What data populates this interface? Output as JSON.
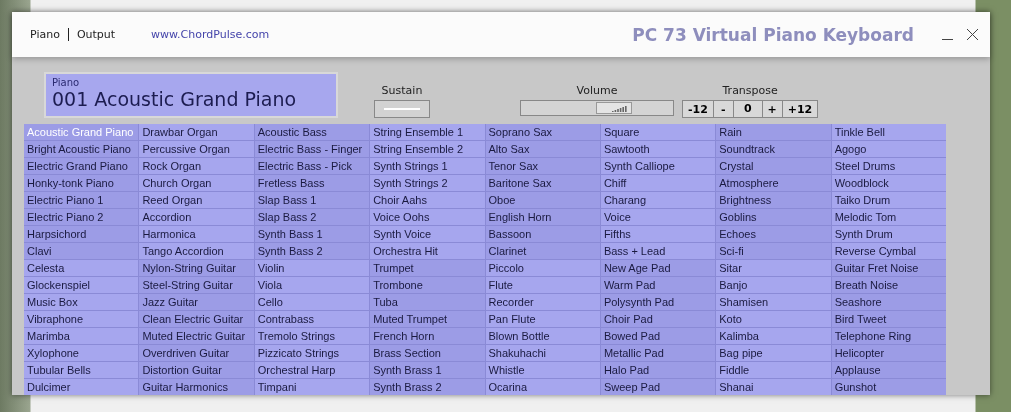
{
  "menu": [
    {
      "label": "Piano"
    },
    {
      "label": "Output"
    }
  ],
  "link": "www.ChordPulse.com",
  "window": {
    "title": "PC 73 Virtual Piano Keyboard"
  },
  "display": {
    "label": "Piano",
    "value": "001 Acoustic Grand Piano"
  },
  "sustain": {
    "label": "Sustain"
  },
  "volume": {
    "label": "Volume",
    "level": 0.66
  },
  "transpose": {
    "label": "Transpose",
    "buttons": [
      {
        "label": "-12",
        "kind": "button"
      },
      {
        "label": "-",
        "kind": "button"
      },
      {
        "label": "0",
        "kind": "value"
      },
      {
        "label": "+",
        "kind": "button"
      },
      {
        "label": "+12",
        "kind": "button"
      }
    ]
  },
  "instruments": [
    [
      {
        "name": "Acoustic Grand Piano",
        "selected": true
      },
      {
        "name": "Bright Acoustic Piano",
        "selected": false
      },
      {
        "name": "Electric Grand Piano",
        "selected": false
      },
      {
        "name": "Honky-tonk Piano",
        "selected": false
      },
      {
        "name": "Electric Piano 1",
        "selected": false
      },
      {
        "name": "Electric Piano 2",
        "selected": false
      },
      {
        "name": "Harpsichord",
        "selected": false
      },
      {
        "name": "Clavi",
        "selected": false
      },
      {
        "name": "Celesta",
        "selected": false
      },
      {
        "name": "Glockenspiel",
        "selected": false
      },
      {
        "name": "Music Box",
        "selected": false
      },
      {
        "name": "Vibraphone",
        "selected": false
      },
      {
        "name": "Marimba",
        "selected": false
      },
      {
        "name": "Xylophone",
        "selected": false
      },
      {
        "name": "Tubular Bells",
        "selected": false
      },
      {
        "name": "Dulcimer",
        "selected": false
      }
    ],
    [
      {
        "name": "Drawbar Organ",
        "selected": false
      },
      {
        "name": "Percussive Organ",
        "selected": false
      },
      {
        "name": "Rock Organ",
        "selected": false
      },
      {
        "name": "Church Organ",
        "selected": false
      },
      {
        "name": "Reed Organ",
        "selected": false
      },
      {
        "name": "Accordion",
        "selected": false
      },
      {
        "name": "Harmonica",
        "selected": false
      },
      {
        "name": "Tango Accordion",
        "selected": false
      },
      {
        "name": "Nylon-String Guitar",
        "selected": false
      },
      {
        "name": "Steel-String Guitar",
        "selected": false
      },
      {
        "name": "Jazz Guitar",
        "selected": false
      },
      {
        "name": "Clean Electric Guitar",
        "selected": false
      },
      {
        "name": "Muted Electric Guitar",
        "selected": false
      },
      {
        "name": "Overdriven Guitar",
        "selected": false
      },
      {
        "name": "Distortion Guitar",
        "selected": false
      },
      {
        "name": "Guitar Harmonics",
        "selected": false
      }
    ],
    [
      {
        "name": "Acoustic Bass",
        "selected": false
      },
      {
        "name": "Electric Bass - Finger",
        "selected": false
      },
      {
        "name": "Electric Bass - Pick",
        "selected": false
      },
      {
        "name": "Fretless Bass",
        "selected": false
      },
      {
        "name": "Slap Bass 1",
        "selected": false
      },
      {
        "name": "Slap Bass 2",
        "selected": false
      },
      {
        "name": "Synth Bass 1",
        "selected": false
      },
      {
        "name": "Synth Bass 2",
        "selected": false
      },
      {
        "name": "Violin",
        "selected": false
      },
      {
        "name": "Viola",
        "selected": false
      },
      {
        "name": "Cello",
        "selected": false
      },
      {
        "name": "Contrabass",
        "selected": false
      },
      {
        "name": "Tremolo Strings",
        "selected": false
      },
      {
        "name": "Pizzicato Strings",
        "selected": false
      },
      {
        "name": "Orchestral Harp",
        "selected": false
      },
      {
        "name": "Timpani",
        "selected": false
      }
    ],
    [
      {
        "name": "String Ensemble 1",
        "selected": false
      },
      {
        "name": "String Ensemble 2",
        "selected": false
      },
      {
        "name": "Synth Strings 1",
        "selected": false
      },
      {
        "name": "Synth Strings 2",
        "selected": false
      },
      {
        "name": "Choir Aahs",
        "selected": false
      },
      {
        "name": "Voice Oohs",
        "selected": false
      },
      {
        "name": "Synth Voice",
        "selected": false
      },
      {
        "name": "Orchestra Hit",
        "selected": false
      },
      {
        "name": "Trumpet",
        "selected": false
      },
      {
        "name": "Trombone",
        "selected": false
      },
      {
        "name": "Tuba",
        "selected": false
      },
      {
        "name": "Muted Trumpet",
        "selected": false
      },
      {
        "name": "French Horn",
        "selected": false
      },
      {
        "name": "Brass Section",
        "selected": false
      },
      {
        "name": "Synth Brass 1",
        "selected": false
      },
      {
        "name": "Synth Brass 2",
        "selected": false
      }
    ],
    [
      {
        "name": "Soprano Sax",
        "selected": false
      },
      {
        "name": "Alto Sax",
        "selected": false
      },
      {
        "name": "Tenor Sax",
        "selected": false
      },
      {
        "name": "Baritone Sax",
        "selected": false
      },
      {
        "name": "Oboe",
        "selected": false
      },
      {
        "name": "English Horn",
        "selected": false
      },
      {
        "name": "Bassoon",
        "selected": false
      },
      {
        "name": "Clarinet",
        "selected": false
      },
      {
        "name": "Piccolo",
        "selected": false
      },
      {
        "name": "Flute",
        "selected": false
      },
      {
        "name": "Recorder",
        "selected": false
      },
      {
        "name": "Pan Flute",
        "selected": false
      },
      {
        "name": "Blown Bottle",
        "selected": false
      },
      {
        "name": "Shakuhachi",
        "selected": false
      },
      {
        "name": "Whistle",
        "selected": false
      },
      {
        "name": "Ocarina",
        "selected": false
      }
    ],
    [
      {
        "name": "Square",
        "selected": false
      },
      {
        "name": "Sawtooth",
        "selected": false
      },
      {
        "name": "Synth Calliope",
        "selected": false
      },
      {
        "name": "Chiff",
        "selected": false
      },
      {
        "name": "Charang",
        "selected": false
      },
      {
        "name": "Voice",
        "selected": false
      },
      {
        "name": "Fifths",
        "selected": false
      },
      {
        "name": "Bass + Lead",
        "selected": false
      },
      {
        "name": "New Age Pad",
        "selected": false
      },
      {
        "name": "Warm Pad",
        "selected": false
      },
      {
        "name": "Polysynth Pad",
        "selected": false
      },
      {
        "name": "Choir Pad",
        "selected": false
      },
      {
        "name": "Bowed Pad",
        "selected": false
      },
      {
        "name": "Metallic Pad",
        "selected": false
      },
      {
        "name": "Halo Pad",
        "selected": false
      },
      {
        "name": "Sweep Pad",
        "selected": false
      }
    ],
    [
      {
        "name": "Rain",
        "selected": false
      },
      {
        "name": "Soundtrack",
        "selected": false
      },
      {
        "name": "Crystal",
        "selected": false
      },
      {
        "name": "Atmosphere",
        "selected": false
      },
      {
        "name": "Brightness",
        "selected": false
      },
      {
        "name": "Goblins",
        "selected": false
      },
      {
        "name": "Echoes",
        "selected": false
      },
      {
        "name": "Sci-fi",
        "selected": false
      },
      {
        "name": "Sitar",
        "selected": false
      },
      {
        "name": "Banjo",
        "selected": false
      },
      {
        "name": "Shamisen",
        "selected": false
      },
      {
        "name": "Koto",
        "selected": false
      },
      {
        "name": "Kalimba",
        "selected": false
      },
      {
        "name": "Bag pipe",
        "selected": false
      },
      {
        "name": "Fiddle",
        "selected": false
      },
      {
        "name": "Shanai",
        "selected": false
      }
    ],
    [
      {
        "name": "Tinkle Bell",
        "selected": false
      },
      {
        "name": "Agogo",
        "selected": false
      },
      {
        "name": "Steel Drums",
        "selected": false
      },
      {
        "name": "Woodblock",
        "selected": false
      },
      {
        "name": "Taiko Drum",
        "selected": false
      },
      {
        "name": "Melodic Tom",
        "selected": false
      },
      {
        "name": "Synth Drum",
        "selected": false
      },
      {
        "name": "Reverse Cymbal",
        "selected": false
      },
      {
        "name": "Guitar Fret Noise",
        "selected": false
      },
      {
        "name": "Breath Noise",
        "selected": false
      },
      {
        "name": "Seashore",
        "selected": false
      },
      {
        "name": "Bird Tweet",
        "selected": false
      },
      {
        "name": "Telephone Ring",
        "selected": false
      },
      {
        "name": "Helicopter",
        "selected": false
      },
      {
        "name": "Applause",
        "selected": false
      },
      {
        "name": "Gunshot",
        "selected": false
      }
    ]
  ]
}
